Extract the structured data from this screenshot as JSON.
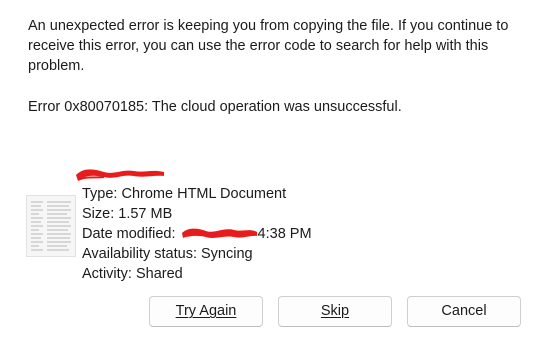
{
  "dialog": {
    "message": "An unexpected error is keeping you from copying the file. If you continue to receive this error, you can use the error code to search for help with this problem.",
    "error": "Error 0x80070185: The cloud operation was unsuccessful."
  },
  "file": {
    "type": "Type: Chrome HTML Document",
    "size": "Size: 1.57 MB",
    "date_prefix": "Date modified: ",
    "date_suffix": "4:38 PM",
    "availability": "Availability status: Syncing",
    "activity": "Activity: Shared"
  },
  "buttons": {
    "try_again": "Try Again",
    "skip": "Skip",
    "cancel": "Cancel"
  },
  "colors": {
    "redaction": "#e81c1c",
    "text": "#1b1b1b",
    "button_border": "#cfcfcf"
  }
}
